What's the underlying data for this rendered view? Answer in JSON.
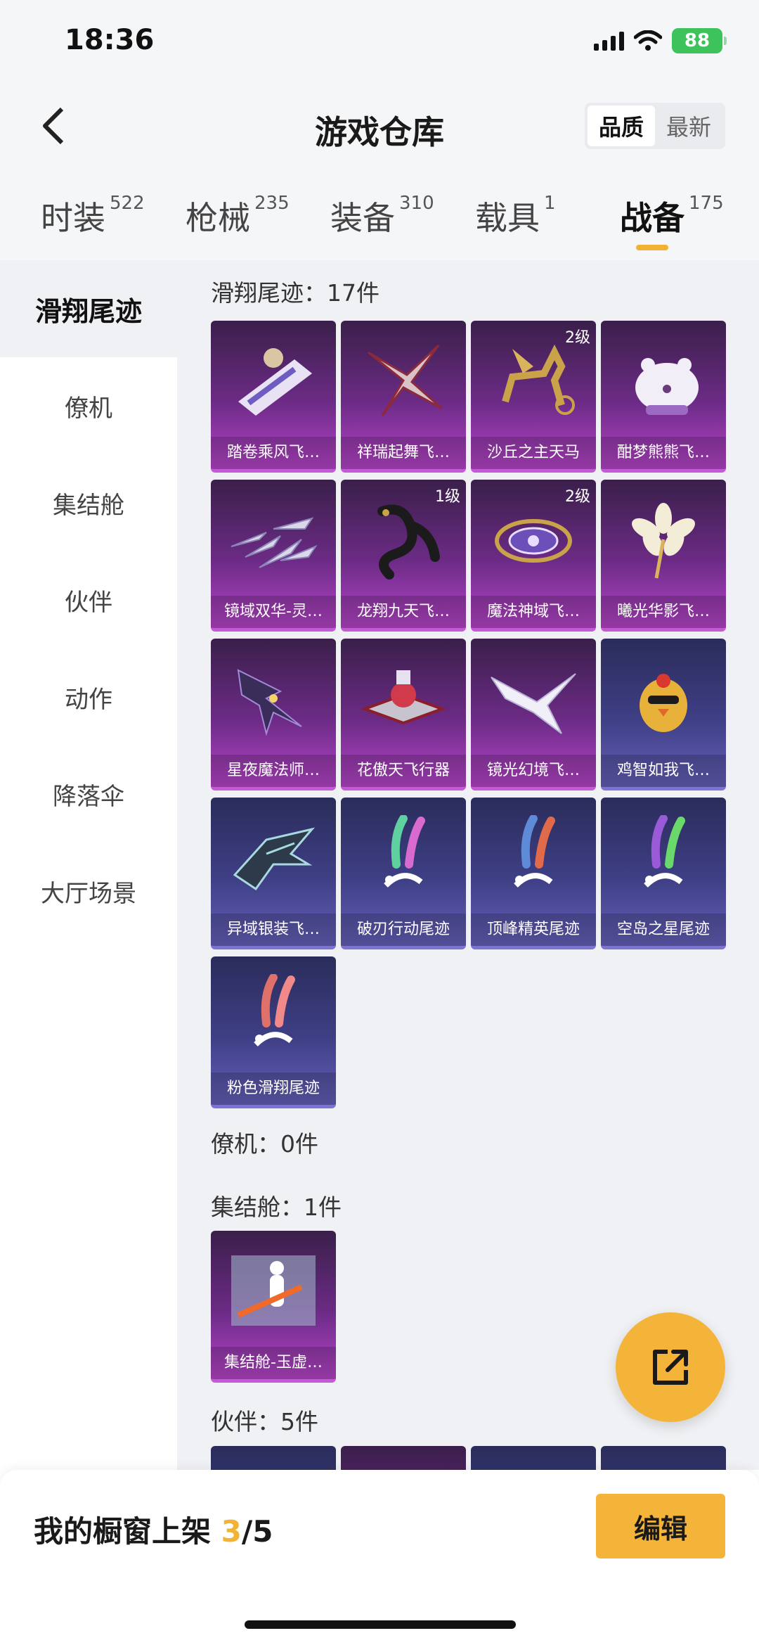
{
  "status": {
    "time": "18:36",
    "battery": "88"
  },
  "header": {
    "title": "游戏仓库",
    "sort_options": [
      "品质",
      "最新"
    ],
    "active_sort": "品质"
  },
  "tabs": [
    {
      "label": "时装",
      "count": "522"
    },
    {
      "label": "枪械",
      "count": "235"
    },
    {
      "label": "装备",
      "count": "310"
    },
    {
      "label": "载具",
      "count": "1"
    },
    {
      "label": "战备",
      "count": "175"
    }
  ],
  "sidebar": {
    "items": [
      "滑翔尾迹",
      "僚机",
      "集结舱",
      "伙伴",
      "动作",
      "降落伞",
      "大厅场景"
    ]
  },
  "sections": {
    "glide": {
      "title": "滑翔尾迹：17件"
    },
    "wingman": {
      "title": "僚机：0件"
    },
    "pod": {
      "title": "集结舱：1件"
    },
    "partner": {
      "title": "伙伴：5件"
    }
  },
  "cards": [
    {
      "name": "踏卷乘风飞…",
      "badge": "",
      "icon": "scroll-icon"
    },
    {
      "name": "祥瑞起舞飞…",
      "badge": "",
      "icon": "shuriken-icon"
    },
    {
      "name": "沙丘之主天马",
      "badge": "2级",
      "icon": "pegasus-icon"
    },
    {
      "name": "酣梦熊熊飞…",
      "badge": "",
      "icon": "bear-icon"
    },
    {
      "name": "镜域双华-灵…",
      "badge": "",
      "icon": "crystal-wing-icon"
    },
    {
      "name": "龙翔九天飞…",
      "badge": "1级",
      "icon": "dragon-icon"
    },
    {
      "name": "魔法神域飞…",
      "badge": "2级",
      "icon": "magic-disc-icon"
    },
    {
      "name": "曦光华影飞…",
      "badge": "",
      "icon": "flower-icon"
    },
    {
      "name": "星夜魔法师…",
      "badge": "",
      "icon": "dark-wing-icon"
    },
    {
      "name": "花傲天飞行器",
      "badge": "",
      "icon": "flying-machine-icon"
    },
    {
      "name": "镜光幻境飞…",
      "badge": "",
      "icon": "white-wing-icon"
    },
    {
      "name": "鸡智如我飞…",
      "badge": "",
      "icon": "chicken-icon"
    },
    {
      "name": "异域银装飞…",
      "badge": "",
      "icon": "silver-glider-icon"
    },
    {
      "name": "破刃行动尾迹",
      "badge": "",
      "icon": "trail-icon"
    },
    {
      "name": "顶峰精英尾迹",
      "badge": "",
      "icon": "trail-icon"
    },
    {
      "name": "空岛之星尾迹",
      "badge": "",
      "icon": "trail-icon"
    },
    {
      "name": "粉色滑翔尾迹",
      "badge": "",
      "icon": "trail-icon"
    }
  ],
  "pod_card": {
    "name": "集结舱-玉虚…",
    "icon": "pod-icon"
  },
  "bottom": {
    "showcase_label": "我的橱窗上架",
    "showcase_current": "3",
    "showcase_total": "/5",
    "edit_label": "编辑"
  },
  "colors": {
    "accent": "#f4b43a",
    "purple_rarity": "#b645c9",
    "blue_rarity": "#6560b9"
  }
}
